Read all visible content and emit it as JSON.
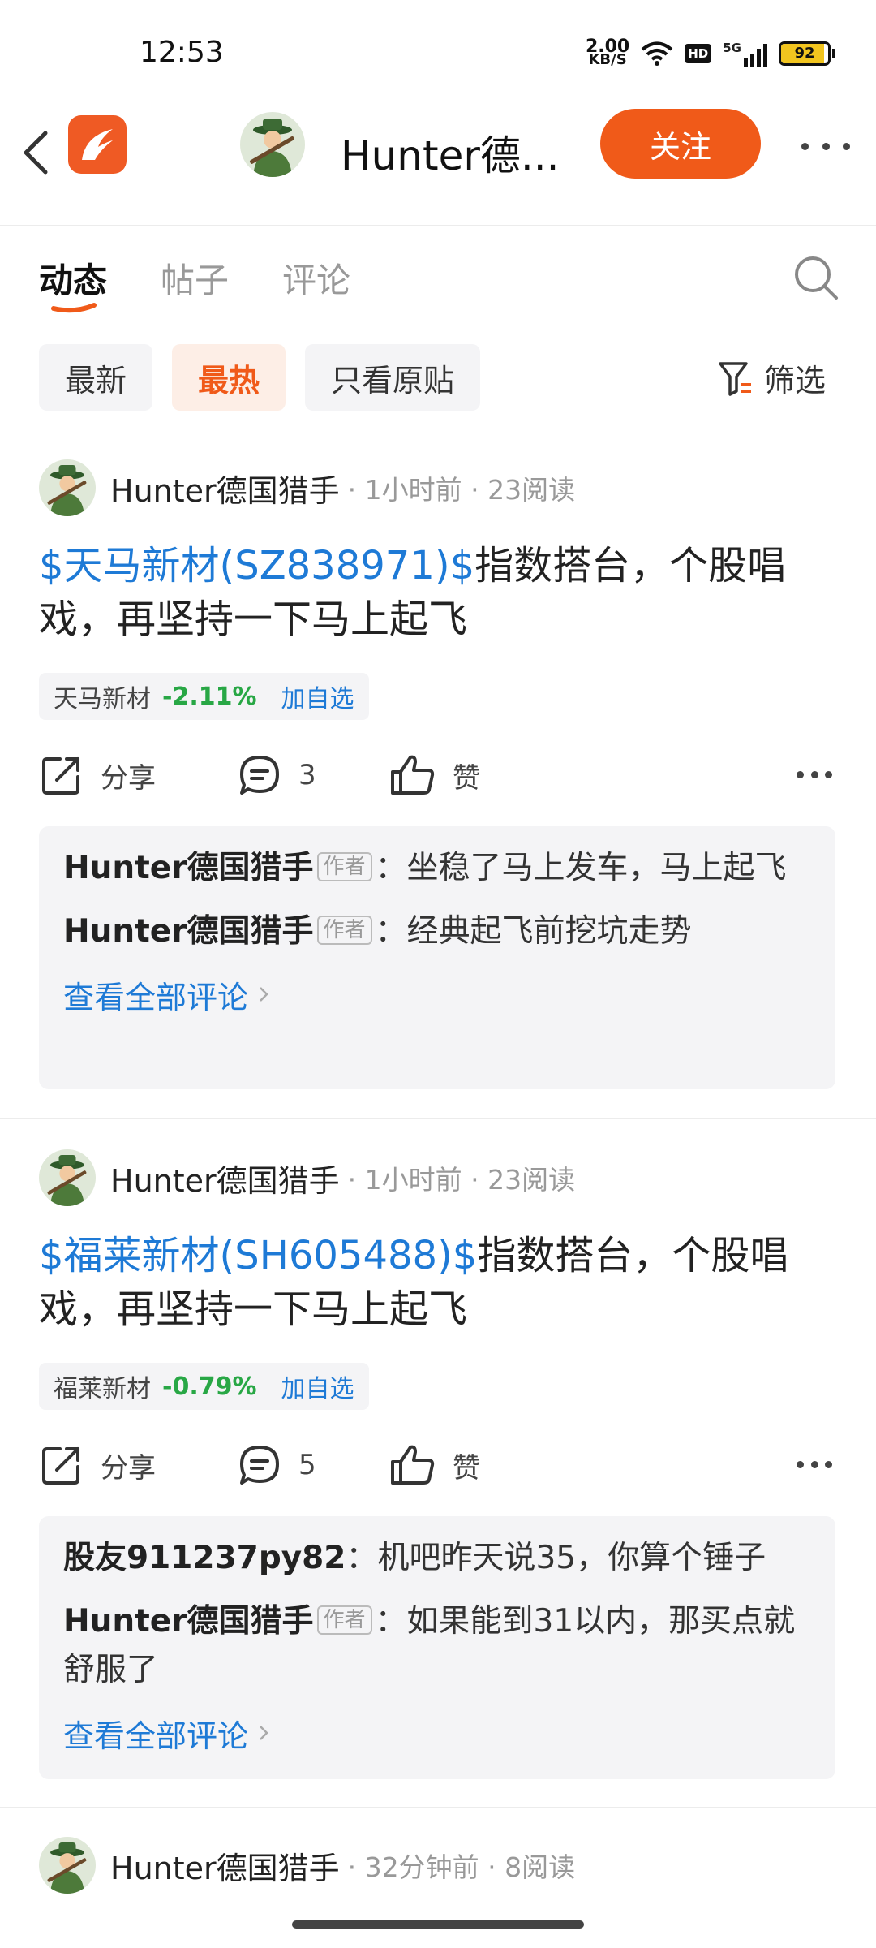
{
  "status_bar": {
    "time": "12:53",
    "speed_value": "2.00",
    "speed_unit": "KB/S",
    "hd": "HD",
    "network": "5G",
    "battery": "92",
    "battery_level": 0.92
  },
  "header": {
    "title": "Hunter德...",
    "follow_label": "关注"
  },
  "tabs": [
    "动态",
    "帖子",
    "评论"
  ],
  "chips": [
    "最新",
    "最热",
    "只看原贴"
  ],
  "filter_label": "筛选",
  "colors": {
    "accent": "#f05a19",
    "link": "#1e7ad6",
    "down": "#28a745"
  },
  "posts": [
    {
      "author": "Hunter德国猎手",
      "info": "· 1小时前 · 23阅读",
      "stock_link": "$天马新材(SZ838971)$",
      "text": "指数搭台，个股唱戏，再坚持一下马上起飞",
      "quote": {
        "name": "天马新材",
        "change": "-2.11%",
        "add": "加自选"
      },
      "share": "分享",
      "comments_count": "3",
      "like": "赞",
      "comments": [
        {
          "author": "Hunter德国猎手",
          "badge": "作者",
          "text": "：坐稳了马上发车，马上起飞"
        },
        {
          "author": "Hunter德国猎手",
          "badge": "作者",
          "text": "：经典起飞前挖坑走势"
        }
      ],
      "view_all": "查看全部评论"
    },
    {
      "author": "Hunter德国猎手",
      "info": "· 1小时前 · 23阅读",
      "stock_link": "$福莱新材(SH605488)$",
      "text": "指数搭台，个股唱戏，再坚持一下马上起飞",
      "quote": {
        "name": "福莱新材",
        "change": "-0.79%",
        "add": "加自选"
      },
      "share": "分享",
      "comments_count": "5",
      "like": "赞",
      "comments": [
        {
          "author": "股友911237py82",
          "badge": "",
          "text": "：机吧昨天说35，你算个锤子"
        },
        {
          "author": "Hunter德国猎手",
          "badge": "作者",
          "text": "：如果能到31以内，那买点就舒服了"
        }
      ],
      "view_all": "查看全部评论"
    },
    {
      "author": "Hunter德国猎手",
      "info": "· 32分钟前 · 8阅读"
    }
  ]
}
